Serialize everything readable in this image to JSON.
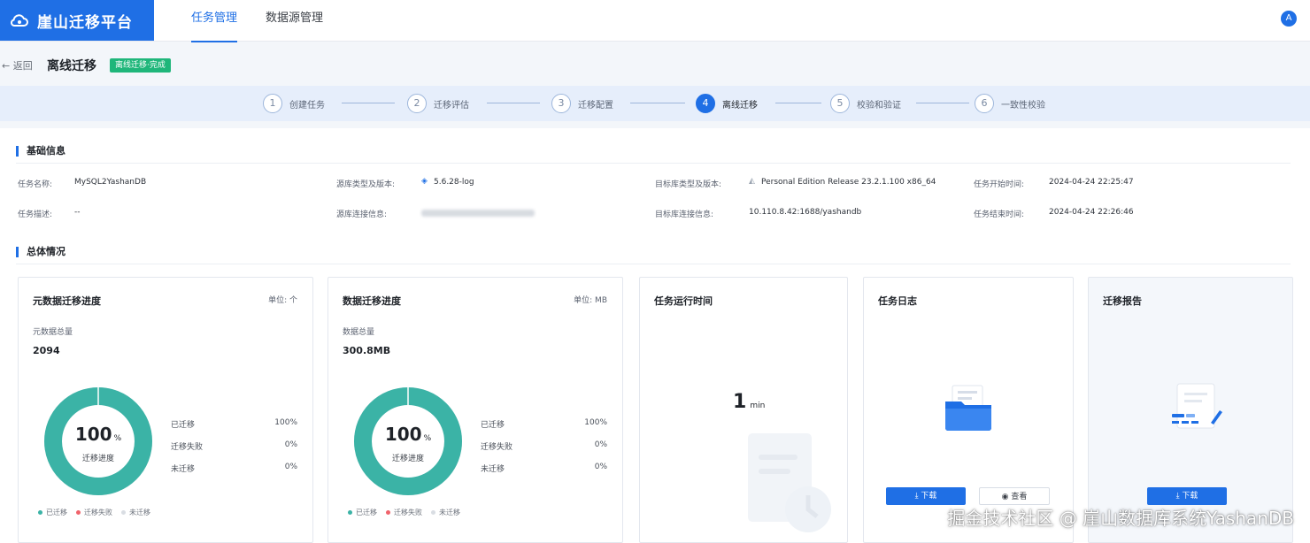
{
  "app": {
    "brand": "崖山迁移平台",
    "avatar": "A"
  },
  "nav": {
    "tabs": [
      "任务管理",
      "数据源管理"
    ]
  },
  "header": {
    "back": "← 返回",
    "title": "离线迁移",
    "badge": "离线迁移·完成"
  },
  "steps": [
    {
      "num": "1",
      "label": "创建任务"
    },
    {
      "num": "2",
      "label": "迁移评估"
    },
    {
      "num": "3",
      "label": "迁移配置"
    },
    {
      "num": "4",
      "label": "离线迁移"
    },
    {
      "num": "5",
      "label": "校验和验证"
    },
    {
      "num": "6",
      "label": "一致性校验"
    }
  ],
  "basic_info": {
    "title": "基础信息",
    "task_name_label": "任务名称:",
    "task_name": "MySQL2YashanDB",
    "task_desc_label": "任务描述:",
    "task_desc": "--",
    "source_type_label": "源库类型及版本:",
    "source_type": "5.6.28-log",
    "source_conn_label": "源库连接信息:",
    "target_type_label": "目标库类型及版本:",
    "target_type": "Personal Edition Release 23.2.1.100 x86_64",
    "target_conn_label": "目标库连接信息:",
    "target_conn": "10.110.8.42:1688/yashandb",
    "start_label": "任务开始时间:",
    "start_time": "2024-04-24 22:25:47",
    "end_label": "任务结束时间:",
    "end_time": "2024-04-24 22:26:46"
  },
  "overview": {
    "title": "总体情况"
  },
  "meta_card": {
    "title": "元数据迁移进度",
    "unit": "单位: 个",
    "total_label": "元数据总量",
    "total": "2094",
    "percent": 100,
    "percent_text": "100",
    "pct_unit": "%",
    "caption": "迁移进度",
    "stats": [
      {
        "label": "已迁移",
        "value": "100%"
      },
      {
        "label": "迁移失败",
        "value": "0%"
      },
      {
        "label": "未迁移",
        "value": "0%"
      }
    ],
    "legend": [
      "已迁移",
      "迁移失败",
      "未迁移"
    ]
  },
  "data_card": {
    "title": "数据迁移进度",
    "unit": "单位: MB",
    "total_label": "数据总量",
    "total": "300.8MB",
    "percent": 100,
    "percent_text": "100",
    "pct_unit": "%",
    "caption": "迁移进度",
    "stats": [
      {
        "label": "已迁移",
        "value": "100%"
      },
      {
        "label": "迁移失败",
        "value": "0%"
      },
      {
        "label": "未迁移",
        "value": "0%"
      }
    ],
    "legend": [
      "已迁移",
      "迁移失败",
      "未迁移"
    ]
  },
  "runtime_card": {
    "title": "任务运行时间",
    "value": "1",
    "unit": "min"
  },
  "log_card": {
    "title": "任务日志",
    "download": "⤓ 下载",
    "view": "◉ 查看"
  },
  "report_card": {
    "title": "迁移报告",
    "download": "⤓ 下载"
  },
  "colors": {
    "accent": "#1f6fe5",
    "success": "#1fb67a",
    "donut": "#3bb3a6",
    "legend_fail": "#f0636b",
    "legend_pending": "#d9dde3"
  },
  "watermark": "掘金技术社区 @ 崖山数据库系统YashanDB"
}
